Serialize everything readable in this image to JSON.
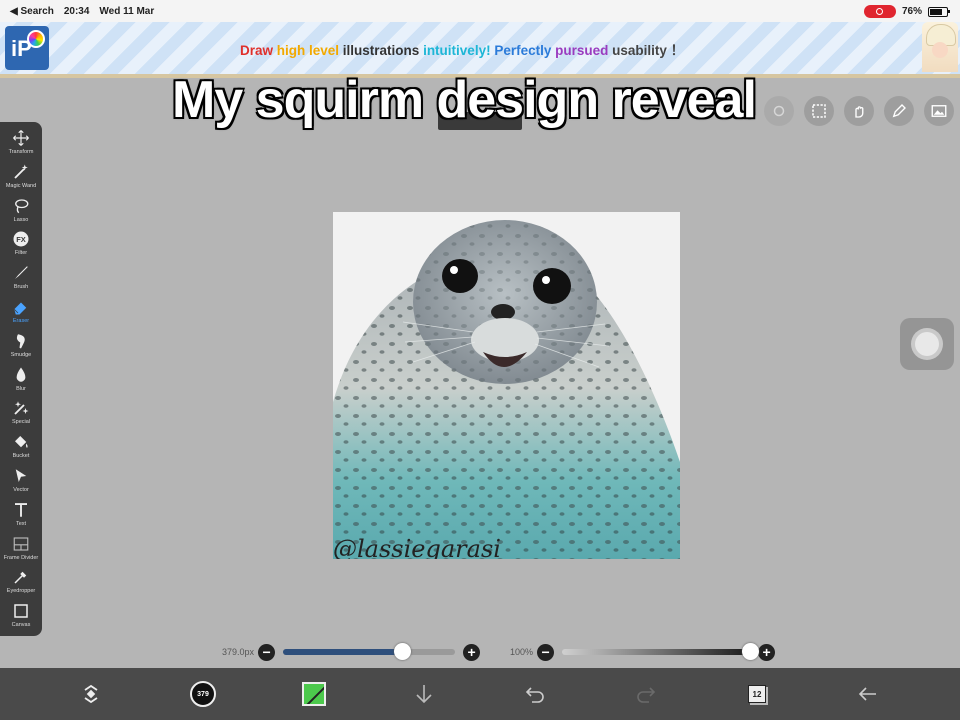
{
  "status_bar": {
    "back_app": "◀ Search",
    "time": "20:34",
    "date": "Wed 11 Mar",
    "battery": "76%"
  },
  "banner": {
    "logo_text": "iP",
    "segments": [
      {
        "text": "Draw ",
        "color": "red"
      },
      {
        "text": "high ",
        "color": "yellow"
      },
      {
        "text": "level ",
        "color": "yellow"
      },
      {
        "text": "illustrations ",
        "color": "black"
      },
      {
        "text": "intuitively! ",
        "color": "cyan"
      },
      {
        "text": "Perfectly ",
        "color": "blue"
      },
      {
        "text": "pursued ",
        "color": "purple"
      },
      {
        "text": "usability ！",
        "color": "gray"
      }
    ]
  },
  "caption": "My squirm design reveal",
  "toolbar": {
    "active": "Eraser",
    "tools": [
      {
        "label": "Transform",
        "icon": "move-icon"
      },
      {
        "label": "Magic Wand",
        "icon": "magic-wand-icon"
      },
      {
        "label": "Lasso",
        "icon": "lasso-icon"
      },
      {
        "label": "Filter",
        "icon": "fx-icon"
      },
      {
        "label": "Brush",
        "icon": "brush-icon"
      },
      {
        "label": "Eraser",
        "icon": "eraser-icon"
      },
      {
        "label": "Smudge",
        "icon": "smudge-icon"
      },
      {
        "label": "Blur",
        "icon": "drop-icon"
      },
      {
        "label": "Special",
        "icon": "sparkle-icon"
      },
      {
        "label": "Bucket",
        "icon": "bucket-icon"
      },
      {
        "label": "Vector",
        "icon": "cursor-icon"
      },
      {
        "label": "Text",
        "icon": "text-icon"
      },
      {
        "label": "Frame Divider",
        "icon": "frame-icon"
      },
      {
        "label": "Eyedropper",
        "icon": "eyedropper-icon"
      },
      {
        "label": "Canvas",
        "icon": "canvas-icon"
      }
    ]
  },
  "canvas": {
    "watermark": "@lassiegarasi"
  },
  "sliders": {
    "size_label": "379.0px",
    "size_fraction": 0.69,
    "opacity_label": "100%",
    "opacity_fraction": 1.0
  },
  "bottom_bar": {
    "brush_size_badge": "379",
    "layer_count": "12",
    "color": "#4cc94c"
  }
}
